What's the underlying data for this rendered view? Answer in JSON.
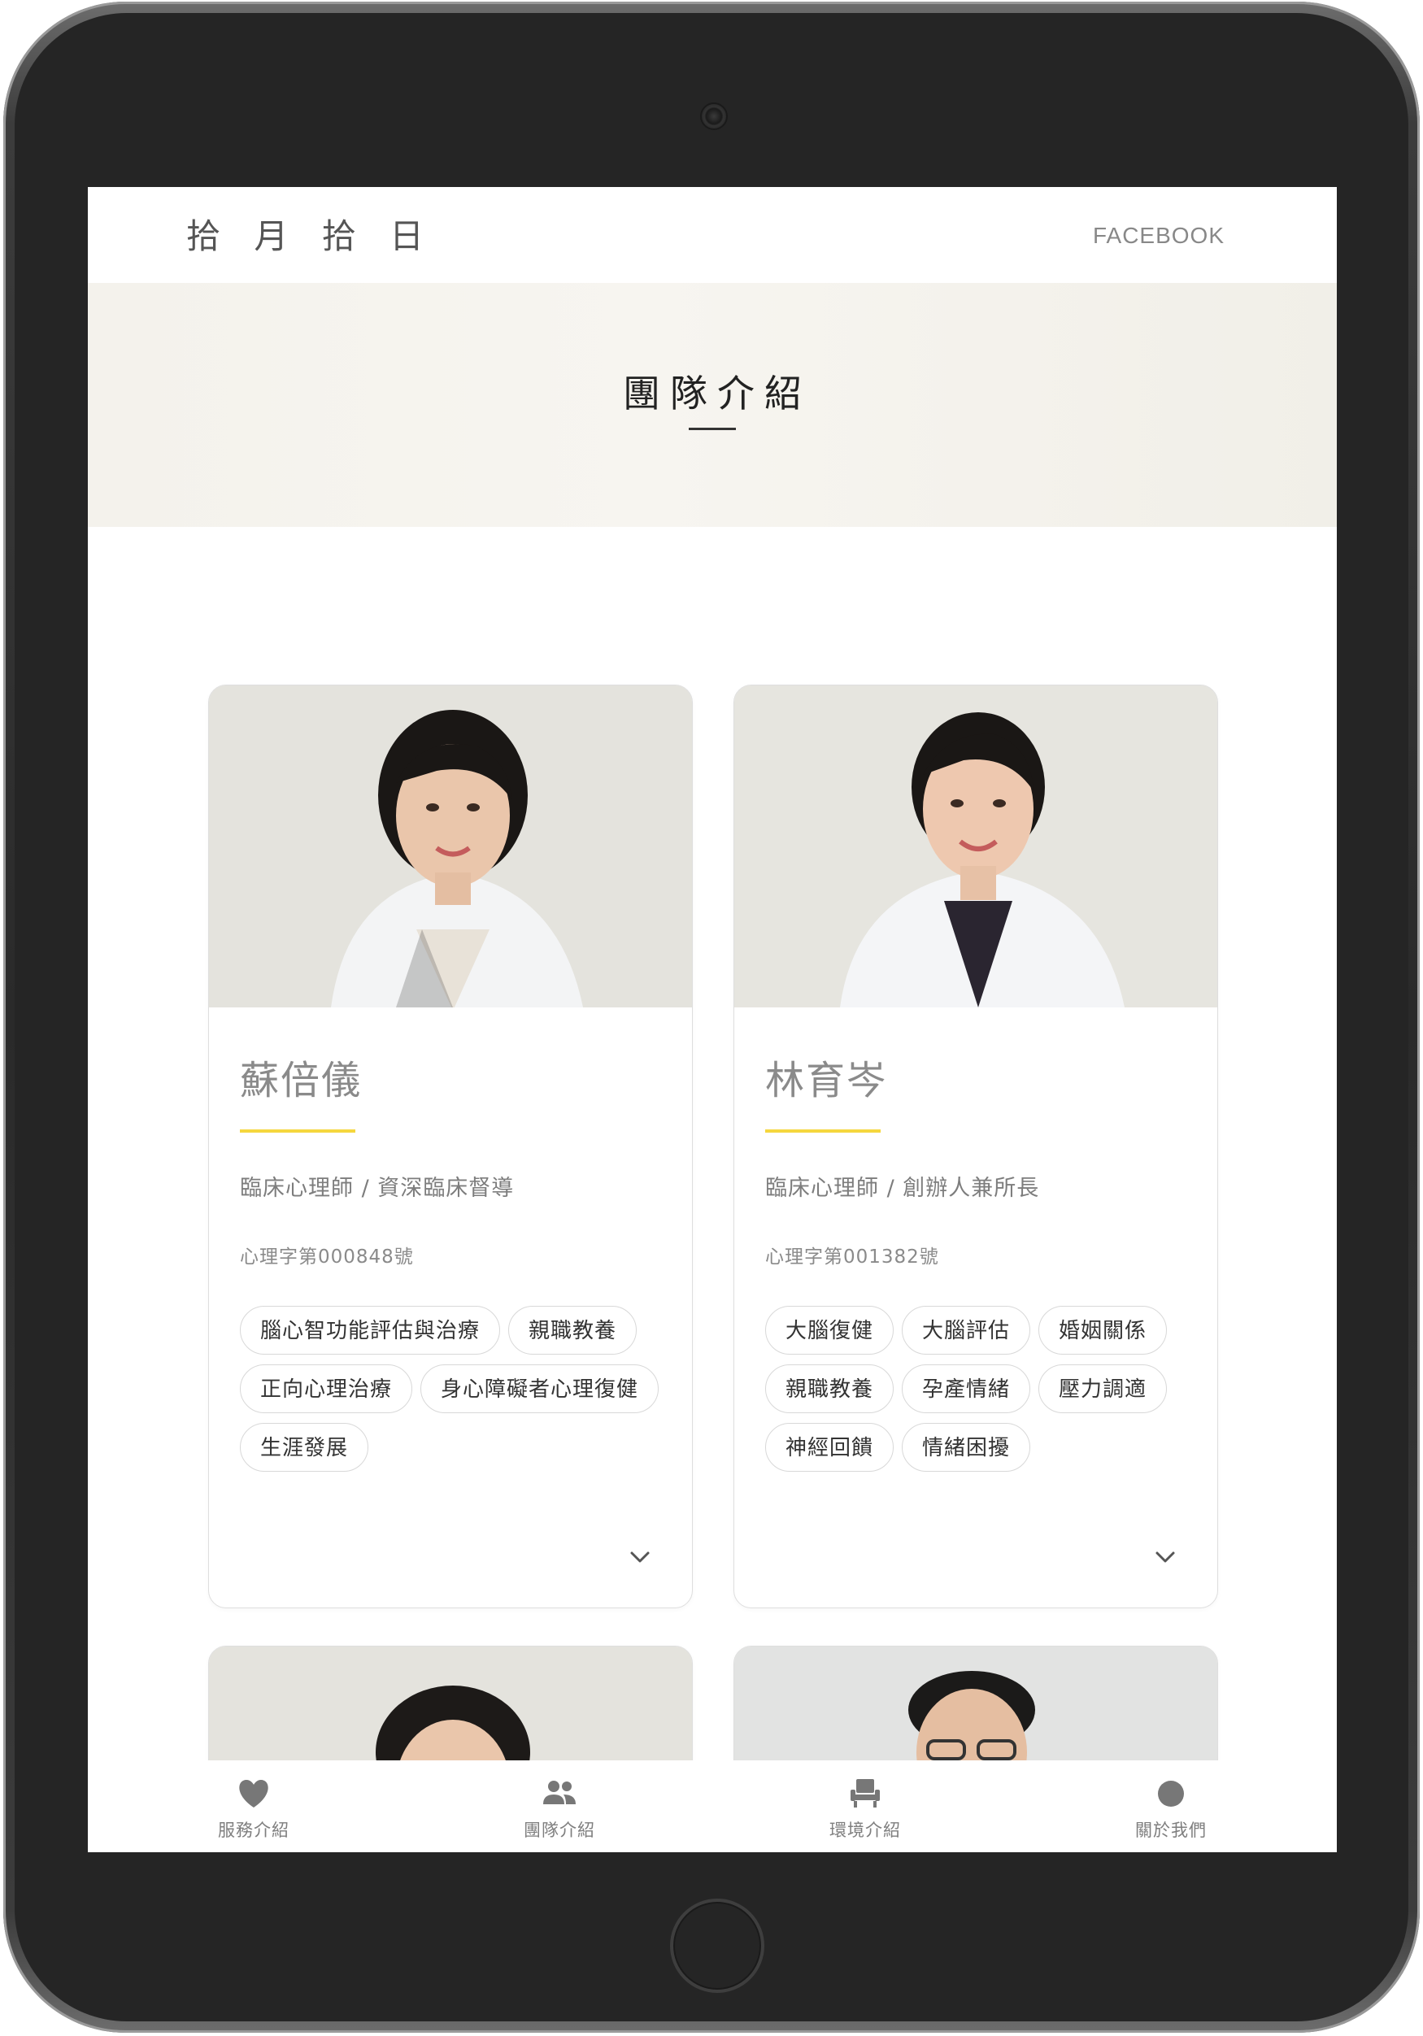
{
  "header": {
    "logo": "拾 月 拾 日",
    "facebook_link": "FACEBOOK"
  },
  "hero": {
    "title": "團隊介紹"
  },
  "members": [
    {
      "name": "蘇倍儀",
      "role": "臨床心理師 / 資深臨床督導",
      "license": "心理字第000848號",
      "tags": [
        "腦心智功能評估與治療",
        "親職教養",
        "正向心理治療",
        "身心障礙者心理復健",
        "生涯發展"
      ]
    },
    {
      "name": "林育岑",
      "role": "臨床心理師 / 創辦人兼所長",
      "license": "心理字第001382號",
      "tags": [
        "大腦復健",
        "大腦評估",
        "婚姻關係",
        "親職教養",
        "孕產情緒",
        "壓力調適",
        "神經回饋",
        "情緒困擾"
      ]
    }
  ],
  "bottom_nav": [
    {
      "label": "服務介紹",
      "icon": "heart-icon"
    },
    {
      "label": "團隊介紹",
      "icon": "people-icon"
    },
    {
      "label": "環境介紹",
      "icon": "chair-icon"
    },
    {
      "label": "關於我們",
      "icon": "circle-icon"
    }
  ],
  "colors": {
    "accent_yellow": "#f5d73e",
    "hero_bg": "#f4f2ec"
  }
}
